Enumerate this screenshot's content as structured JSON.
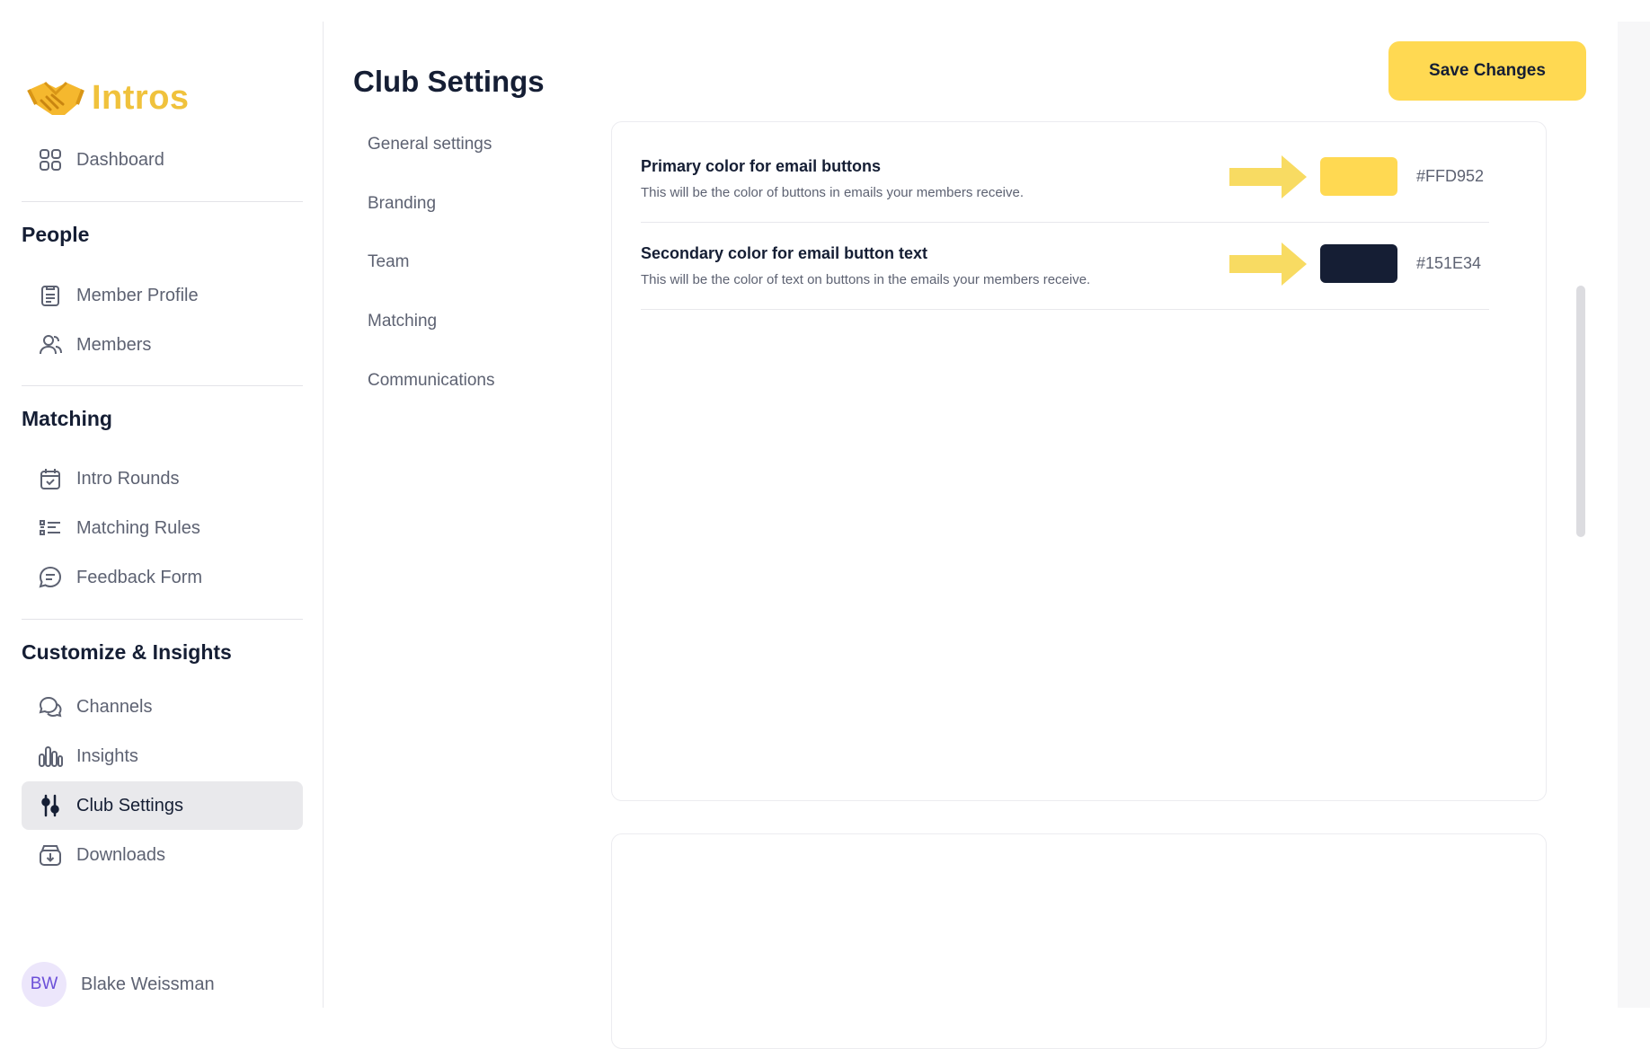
{
  "app": {
    "name": "Intros"
  },
  "sidebar": {
    "dashboard": "Dashboard",
    "sections": {
      "people": "People",
      "matching": "Matching",
      "customize": "Customize & Insights"
    },
    "items": {
      "member_profile": "Member Profile",
      "members": "Members",
      "intro_rounds": "Intro Rounds",
      "matching_rules": "Matching Rules",
      "feedback_form": "Feedback Form",
      "channels": "Channels",
      "insights": "Insights",
      "club_settings": "Club Settings",
      "downloads": "Downloads"
    },
    "active_item": "Club Settings",
    "user": {
      "initials": "BW",
      "name": "Blake Weissman"
    }
  },
  "main": {
    "title": "Club Settings",
    "save_label": "Save Changes",
    "sub_nav": [
      "General settings",
      "Branding",
      "Team",
      "Matching",
      "Communications"
    ],
    "color_settings": [
      {
        "title": "Primary color for email buttons",
        "description": "This will be the color of buttons in emails your members receive.",
        "hex": "#FFD952",
        "color": "#FFD952"
      },
      {
        "title": "Secondary color for email button text",
        "description": "This will be the color of text on buttons in the emails your members receive.",
        "hex": "#151E34",
        "color": "#151E34"
      }
    ]
  },
  "colors": {
    "accent": "#FFD952",
    "dark": "#151E34",
    "logo": "#F0C23C",
    "arrow": "#F8DB62"
  }
}
